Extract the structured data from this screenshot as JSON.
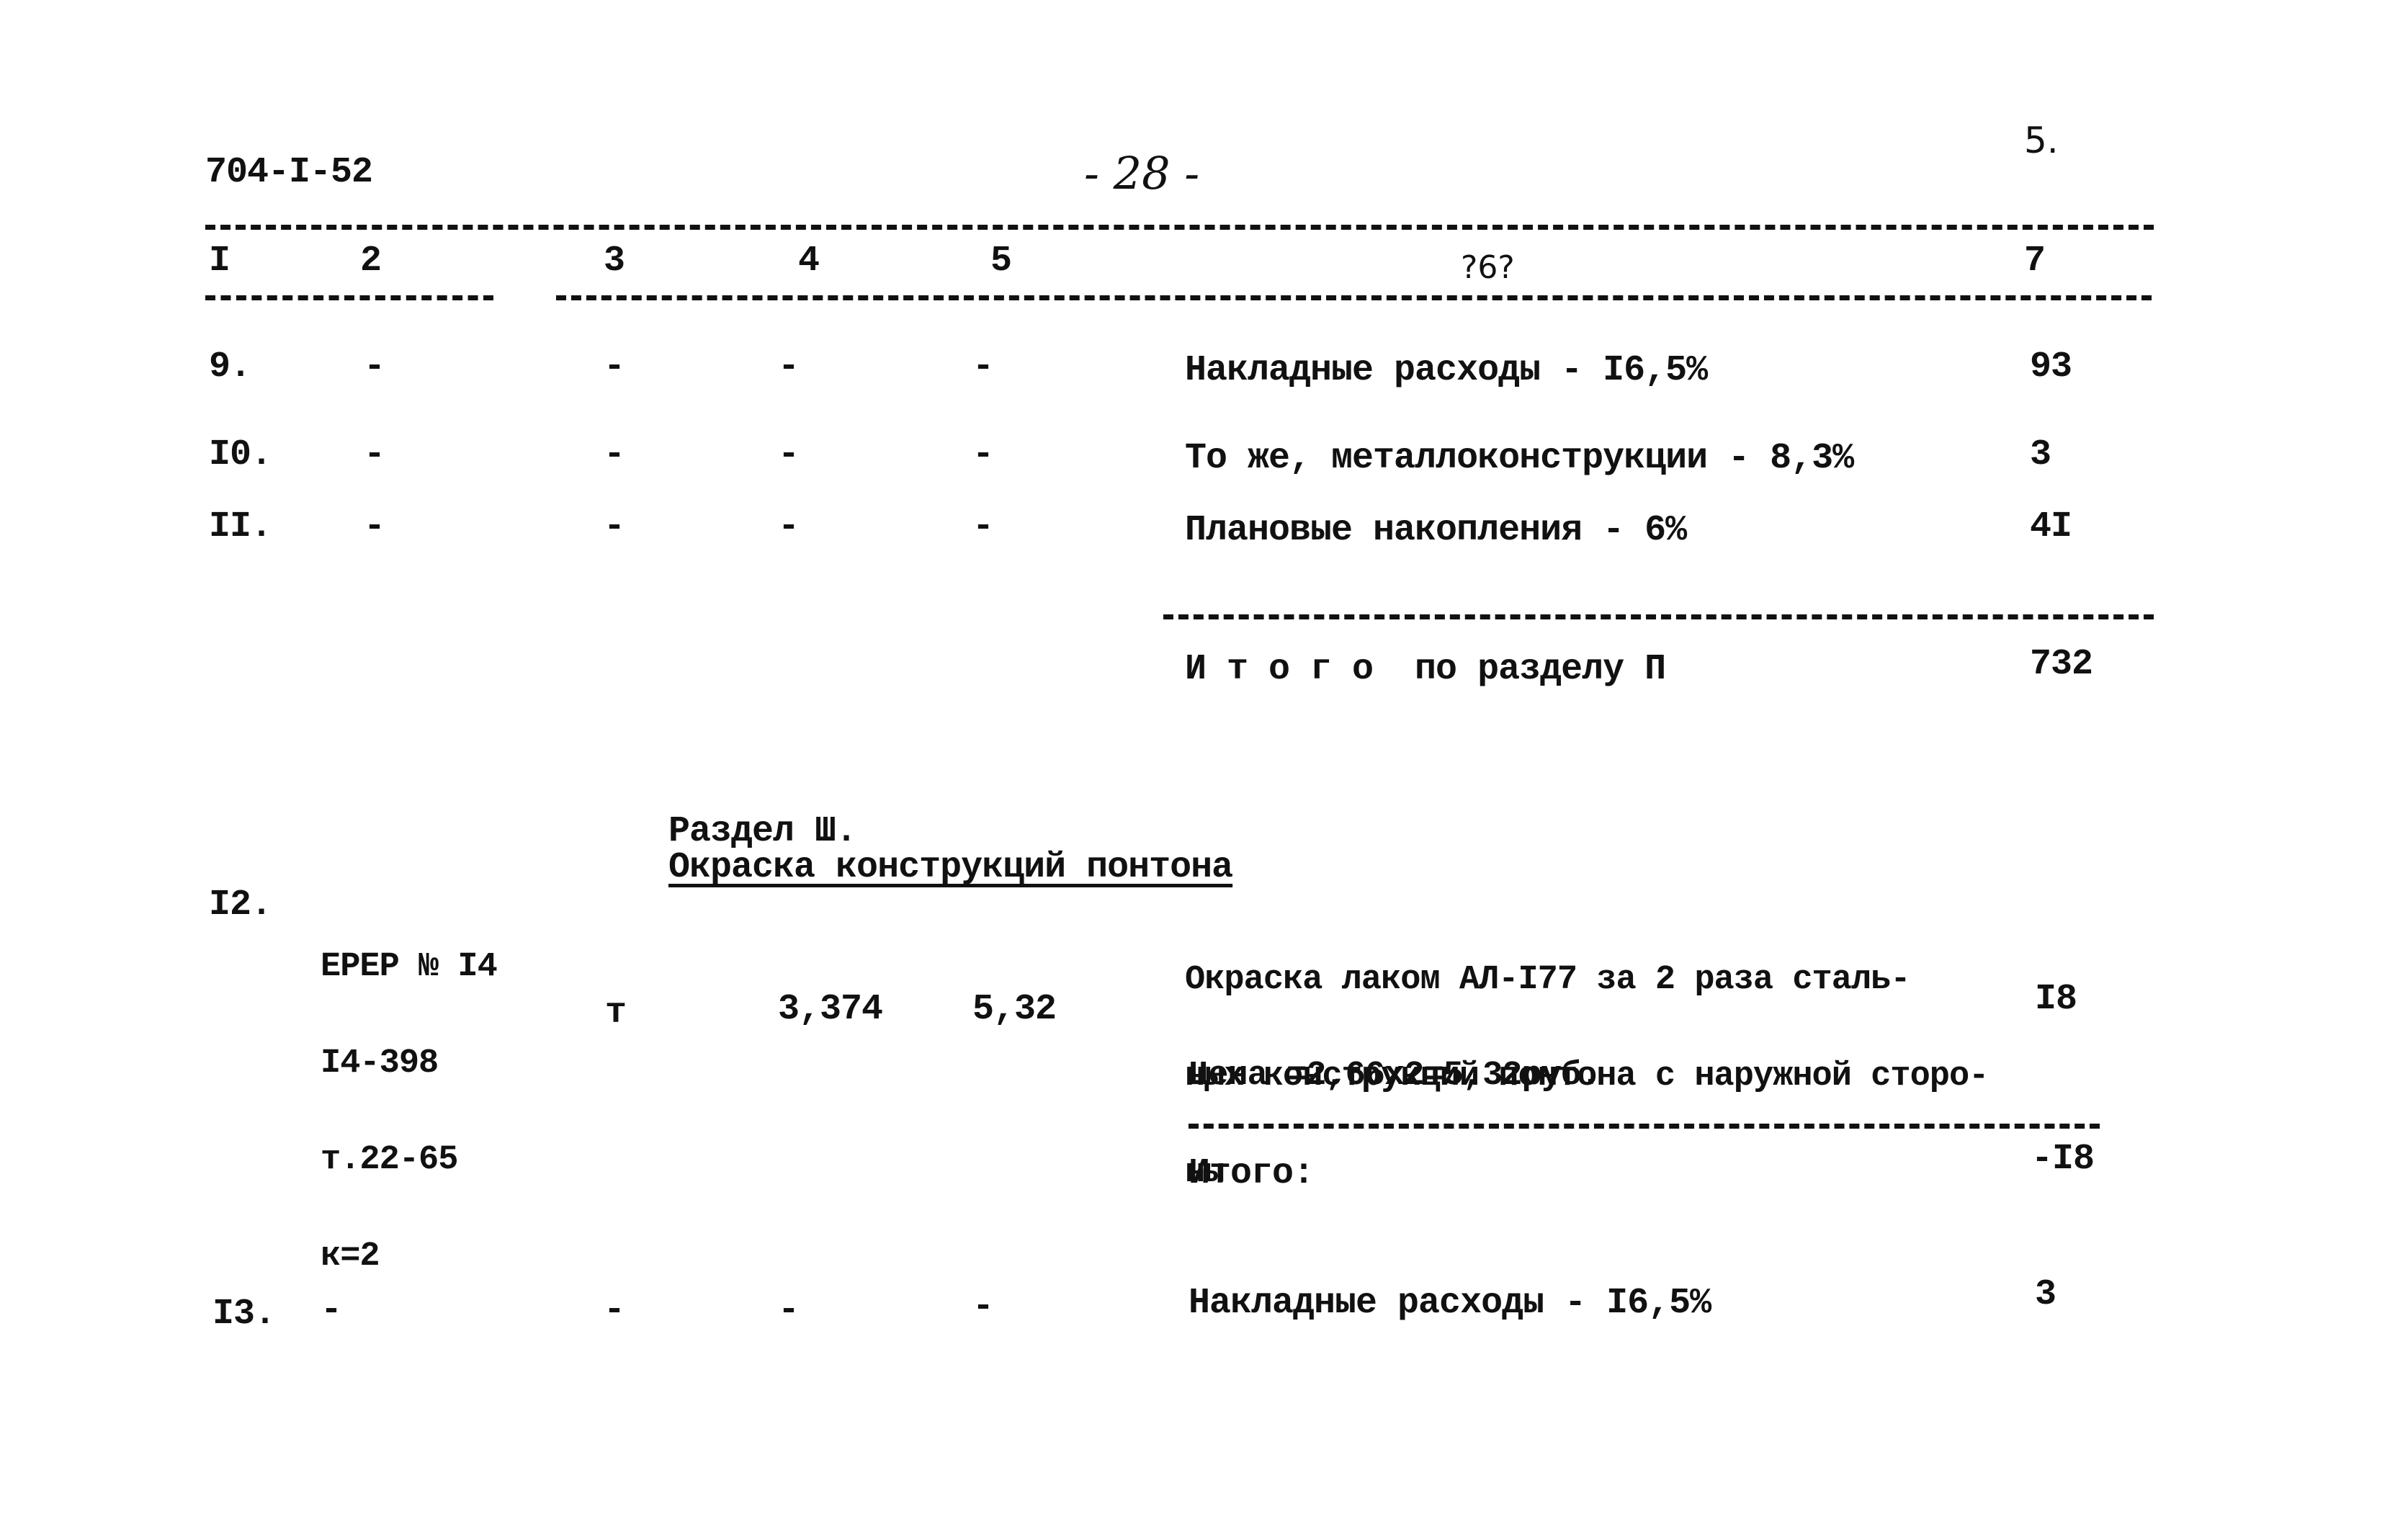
{
  "header": {
    "doc_code": "704-I-52",
    "page_number": "- 28 -",
    "sheet_number": "5."
  },
  "columns": [
    "I",
    "2",
    "3",
    "4",
    "5",
    "?6?",
    "7"
  ],
  "section2_rows": [
    {
      "num": "9.",
      "c2": "-",
      "c3": "-",
      "c4": "-",
      "c5": "-",
      "desc": "Накладные расходы - I6,5%",
      "value": "93"
    },
    {
      "num": "I0.",
      "c2": "-",
      "c3": "-",
      "c4": "-",
      "c5": "-",
      "desc": "То же, металлоконструкции - 8,3%",
      "value": "3"
    },
    {
      "num": "II.",
      "c2": "-",
      "c3": "-",
      "c4": "-",
      "c5": "-",
      "desc": "Плановые накопления - 6%",
      "value": "4I"
    }
  ],
  "section2_total": {
    "label": "И т о г о  по разделу П",
    "value": "732"
  },
  "section3": {
    "prefix": "Раздел Ш.",
    "title": "Окраска конструкций понтона"
  },
  "row12": {
    "num": "I2.",
    "ref_lines": [
      "ЕРЕР № I4",
      "I4-398",
      "т.22-65",
      "к=2"
    ],
    "unit": "т",
    "qty": "3,374",
    "price": "5,32",
    "desc_lines": [
      "Окраска лаком АЛ-I77 за 2 раза сталь-",
      "ных конструкций понтона с наружной сторо-",
      "ны"
    ],
    "value": "I8",
    "price_note": "Цена =2,66х2=5,32руб."
  },
  "section3_subtotal": {
    "label": "Итого:",
    "value": "-I8"
  },
  "row13": {
    "num": "I3.",
    "c2": "-",
    "c3": "-",
    "c4": "-",
    "c5": "-",
    "desc": "Накладные расходы - I6,5%",
    "value": "3"
  }
}
